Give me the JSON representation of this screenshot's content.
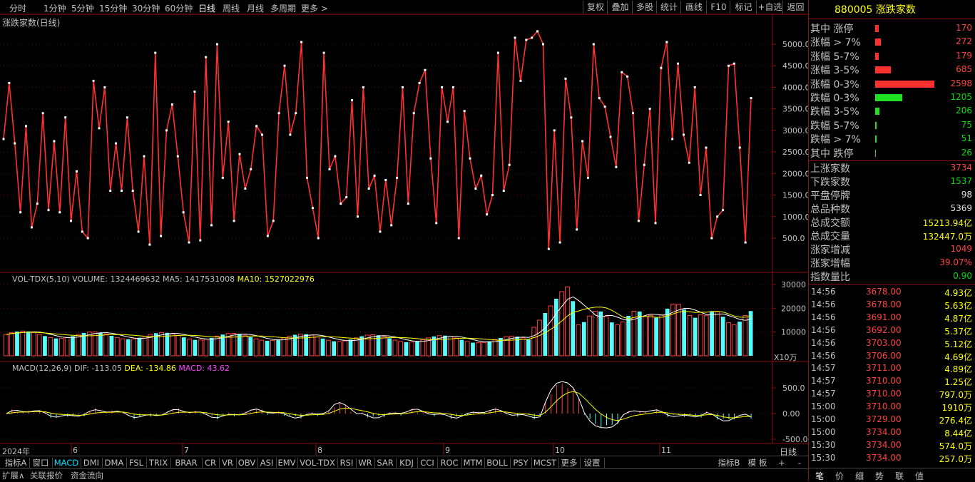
{
  "toolbar": {
    "periods": [
      "分时",
      "1分钟",
      "5分钟",
      "15分钟",
      "30分钟",
      "60分钟",
      "日线",
      "周线",
      "月线",
      "多周期",
      "更多 >"
    ],
    "active_period": "日线",
    "right_buttons": [
      "复权",
      "叠加",
      "多股",
      "统计",
      "画线",
      "F10",
      "标记",
      "+自选",
      "返回"
    ]
  },
  "main_chart": {
    "title": "涨跌家数(日线)",
    "y_ticks": [
      "5000.0",
      "4500.0",
      "4000.0",
      "3500.0",
      "3000.0",
      "2500.0",
      "2000.0",
      "1500.0",
      "1000.0",
      "500.0"
    ]
  },
  "volume_panel": {
    "title": "VOL-TDX(5,10)",
    "volume": "VOLUME: 1324469632",
    "ma5": "MA5: 1417531008",
    "ma10": "MA10: 1527022976",
    "y_ticks": [
      "30000",
      "20000",
      "10000"
    ],
    "unit": "X10万"
  },
  "macd_panel": {
    "title": "MACD(12,26,9)",
    "dif": "DIF: -113.05",
    "dea": "DEA: -134.86",
    "macd": "MACD: 43.62",
    "y_ticks": [
      "500.0",
      "0.00",
      "-500.0"
    ]
  },
  "x_axis": {
    "year": "2024年",
    "months": [
      "6",
      "7",
      "8",
      "9",
      "10",
      "11"
    ],
    "period_label": "日线"
  },
  "chart_data": {
    "type": "line",
    "title": "涨跌家数(日线)",
    "ylim": [
      200,
      5500
    ],
    "series": [
      {
        "values": [
          2800,
          4100,
          2700,
          1100,
          3100,
          750,
          1300,
          3400,
          1150,
          2750,
          1100,
          3300,
          900,
          2050,
          650,
          500,
          4150,
          3050,
          4000,
          1600,
          2700,
          1600,
          3300,
          1600,
          650,
          2400,
          350,
          4800,
          550,
          3000,
          3600,
          2400,
          1100,
          400,
          3900,
          450,
          4700,
          800,
          5000,
          1900,
          3200,
          900,
          2450,
          1650,
          2100,
          3100,
          2900,
          550,
          900,
          3400,
          4500,
          2900,
          3400,
          5050,
          1900,
          1200,
          500,
          4800,
          2100,
          2400,
          1300,
          1450,
          3700,
          1000,
          4000,
          1650,
          1950,
          650,
          1850,
          800,
          1900,
          4000,
          1300,
          3400,
          4100,
          4400,
          2350,
          850,
          4000,
          3200,
          4000,
          500,
          3450,
          2350,
          1650,
          1950,
          1050,
          1500,
          4800,
          1600,
          2200,
          5150,
          4150,
          5100,
          5150,
          5300,
          5000,
          250,
          3000,
          400,
          4200,
          3300,
          700,
          2750,
          1900,
          5000,
          3750,
          3550,
          2850,
          2150,
          4350,
          4250,
          3400,
          900,
          2200,
          3500,
          850,
          4450,
          5050,
          2800,
          4550,
          2900,
          2250,
          4000,
          1500,
          2600,
          500,
          1000,
          1150,
          4500,
          4550,
          2600,
          400,
          3750
        ]
      }
    ]
  },
  "sidebar": {
    "code": "880005",
    "name": "涨跌家数",
    "dist": [
      {
        "label": "其中 涨停",
        "value": "170",
        "color": "red",
        "frac": 0.03
      },
      {
        "label": "涨幅 > 7%",
        "value": "272",
        "color": "red",
        "frac": 0.05
      },
      {
        "label": "涨幅 5-7%",
        "value": "179",
        "color": "red",
        "frac": 0.03
      },
      {
        "label": "涨幅 3-5%",
        "value": "685",
        "color": "red",
        "frac": 0.14
      },
      {
        "label": "涨幅 0-3%",
        "value": "2598",
        "color": "red",
        "frac": 0.52
      },
      {
        "label": "跌幅 0-3%",
        "value": "1205",
        "color": "green",
        "frac": 0.24
      },
      {
        "label": "跌幅 3-5%",
        "value": "206",
        "color": "green",
        "frac": 0.04
      },
      {
        "label": "跌幅 5-7%",
        "value": "75",
        "color": "green",
        "frac": 0.015
      },
      {
        "label": "跌幅 > 7%",
        "value": "51",
        "color": "green",
        "frac": 0.01
      },
      {
        "label": "其中 跌停",
        "value": "26",
        "color": "green",
        "frac": 0.005
      }
    ],
    "stats": [
      {
        "label": "上涨家数",
        "value": "3734",
        "color": "red"
      },
      {
        "label": "下跌家数",
        "value": "1537",
        "color": "green"
      },
      {
        "label": "平盘停牌",
        "value": "98",
        "color": "white"
      },
      {
        "label": "总品种数",
        "value": "5369",
        "color": "white"
      },
      {
        "label": "总成交额",
        "value": "15213.94亿",
        "color": "yellow"
      },
      {
        "label": "总成交量",
        "value": "132447.0万",
        "color": "yellow"
      },
      {
        "label": "涨家增减",
        "value": "1049",
        "color": "red"
      },
      {
        "label": "涨家增幅",
        "value": "39.07%",
        "color": "red"
      },
      {
        "label": "指数量比",
        "value": "0.90",
        "color": "green"
      }
    ],
    "ticks": [
      {
        "time": "14:56",
        "price": "3678.00",
        "vol": "4.93亿"
      },
      {
        "time": "14:56",
        "price": "3678.00",
        "vol": "5.63亿"
      },
      {
        "time": "14:56",
        "price": "3691.00",
        "vol": "4.87亿"
      },
      {
        "time": "14:56",
        "price": "3692.00",
        "vol": "5.37亿"
      },
      {
        "time": "14:56",
        "price": "3703.00",
        "vol": "5.12亿"
      },
      {
        "time": "14:56",
        "price": "3706.00",
        "vol": "4.69亿"
      },
      {
        "time": "14:57",
        "price": "3711.00",
        "vol": "4.89亿"
      },
      {
        "time": "14:57",
        "price": "3710.00",
        "vol": "1.25亿"
      },
      {
        "time": "14:57",
        "price": "3710.00",
        "vol": "797.0万"
      },
      {
        "time": "15:00",
        "price": "3710.00",
        "vol": "1910万"
      },
      {
        "time": "15:00",
        "price": "3729.00",
        "vol": "276.4亿"
      },
      {
        "time": "15:00",
        "price": "3734.00",
        "vol": "8.44亿"
      },
      {
        "time": "15:30",
        "price": "3734.00",
        "vol": "574.0万"
      },
      {
        "time": "15:30",
        "price": "3734.00",
        "vol": "257.0万"
      }
    ],
    "tabs": [
      "笔",
      "价",
      "细",
      "势",
      "联",
      "值"
    ]
  },
  "bottom_tabs": [
    "指标A",
    "窗口",
    "MACD",
    "DMI",
    "DMA",
    "FSL",
    "TRIX",
    "BRAR",
    "CR",
    "VR",
    "OBV",
    "ASI",
    "EMV",
    "VOL-TDX",
    "RSI",
    "WR",
    "SAR",
    "KDJ",
    "CCI",
    "ROC",
    "MTM",
    "BOLL",
    "PSY",
    "MCST",
    "更多",
    "设置"
  ],
  "bottom_tabs_right": [
    "指标B",
    "模 板",
    "+",
    "-"
  ],
  "footer_tabs": [
    "扩展∧",
    "关联报价",
    "资金流向"
  ],
  "active_tab": "MACD"
}
